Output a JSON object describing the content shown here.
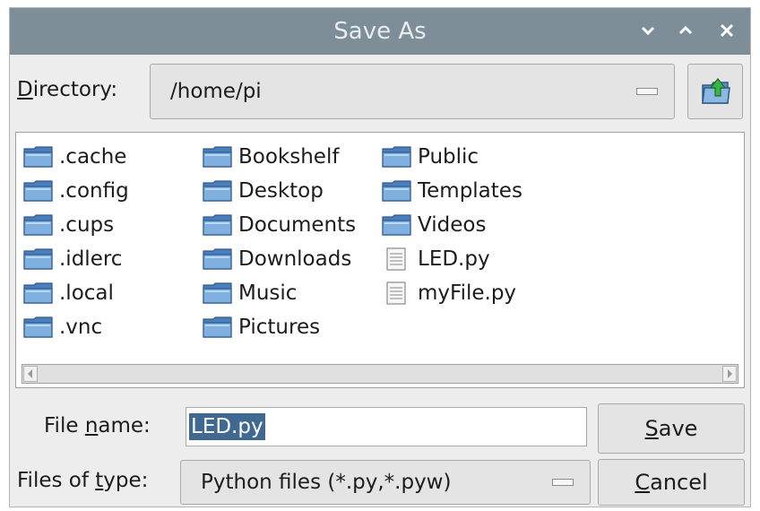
{
  "window": {
    "title": "Save As",
    "controls": {
      "minimize": "⌄",
      "maximize": "⌃",
      "close": "✕"
    }
  },
  "directory": {
    "label_mnemonic": "D",
    "label_rest": "irectory:",
    "value": "/home/pi"
  },
  "files": {
    "columns": [
      [
        {
          "name": ".cache",
          "icon": "folder-icon"
        },
        {
          "name": ".config",
          "icon": "folder-icon"
        },
        {
          "name": ".cups",
          "icon": "folder-icon"
        },
        {
          "name": ".idlerc",
          "icon": "folder-icon"
        },
        {
          "name": ".local",
          "icon": "folder-icon"
        },
        {
          "name": ".vnc",
          "icon": "folder-icon"
        }
      ],
      [
        {
          "name": "Bookshelf",
          "icon": "folder-icon"
        },
        {
          "name": "Desktop",
          "icon": "folder-icon"
        },
        {
          "name": "Documents",
          "icon": "folder-icon"
        },
        {
          "name": "Downloads",
          "icon": "folder-icon"
        },
        {
          "name": "Music",
          "icon": "folder-icon"
        },
        {
          "name": "Pictures",
          "icon": "folder-icon"
        }
      ],
      [
        {
          "name": "Public",
          "icon": "folder-icon"
        },
        {
          "name": "Templates",
          "icon": "folder-icon"
        },
        {
          "name": "Videos",
          "icon": "folder-icon"
        },
        {
          "name": "LED.py",
          "icon": "file-icon"
        },
        {
          "name": "myFile.py",
          "icon": "file-icon"
        }
      ]
    ]
  },
  "filename": {
    "label_before": "File ",
    "label_mnemonic": "n",
    "label_after": "ame:",
    "value": "LED.py"
  },
  "filetype": {
    "label_before": "Files of ",
    "label_mnemonic": "t",
    "label_after": "ype:",
    "value": "Python files (*.py,*.pyw)"
  },
  "buttons": {
    "save_mnemonic": "S",
    "save_rest": "ave",
    "cancel_mnemonic": "C",
    "cancel_rest": "ancel"
  },
  "colors": {
    "titlebar": "#7d8e99",
    "selection": "#3f6991",
    "folder": "#5b8fc9"
  }
}
